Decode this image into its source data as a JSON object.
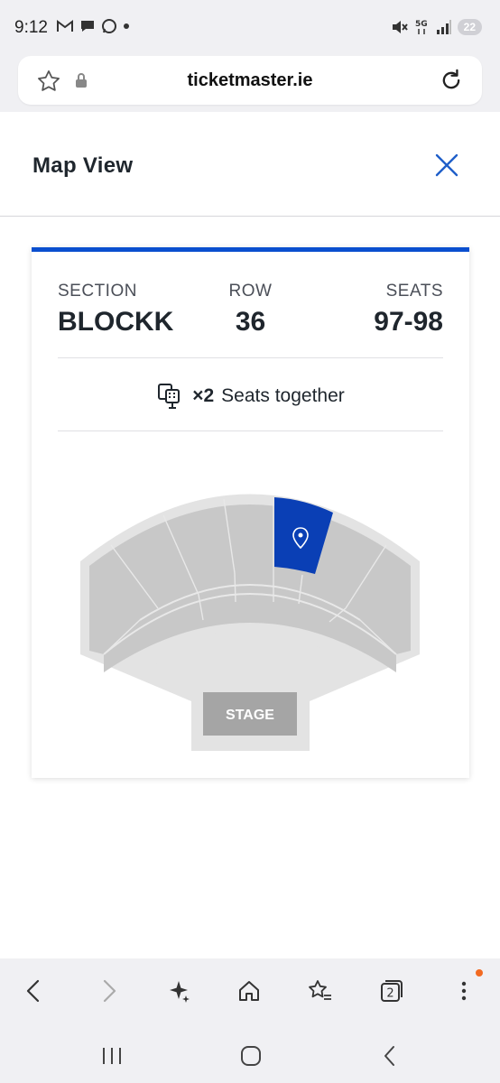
{
  "status_bar": {
    "time": "9:12",
    "battery": "22",
    "left_icons": [
      "gmail-icon",
      "chat-icon",
      "whatsapp-icon",
      "dot-icon"
    ],
    "right_icons": [
      "mute-icon",
      "5g-icon",
      "signal-icon",
      "battery-icon"
    ]
  },
  "browser": {
    "url": "ticketmaster.ie"
  },
  "header": {
    "title": "Map View"
  },
  "ticket": {
    "section_label": "SECTION",
    "section_value": "BLOCKK",
    "row_label": "ROW",
    "row_value": "36",
    "seats_label": "SEATS",
    "seats_value": "97-98",
    "together_count": "×2",
    "together_text": "Seats together"
  },
  "seat_map": {
    "stage_label": "STAGE",
    "highlight_color": "#0a3fb5"
  },
  "toolbar": {
    "tab_count": "2"
  },
  "colors": {
    "accent": "#0a4fcf",
    "section_fill": "#c8c8c8",
    "map_outline": "#e3e3e3"
  }
}
